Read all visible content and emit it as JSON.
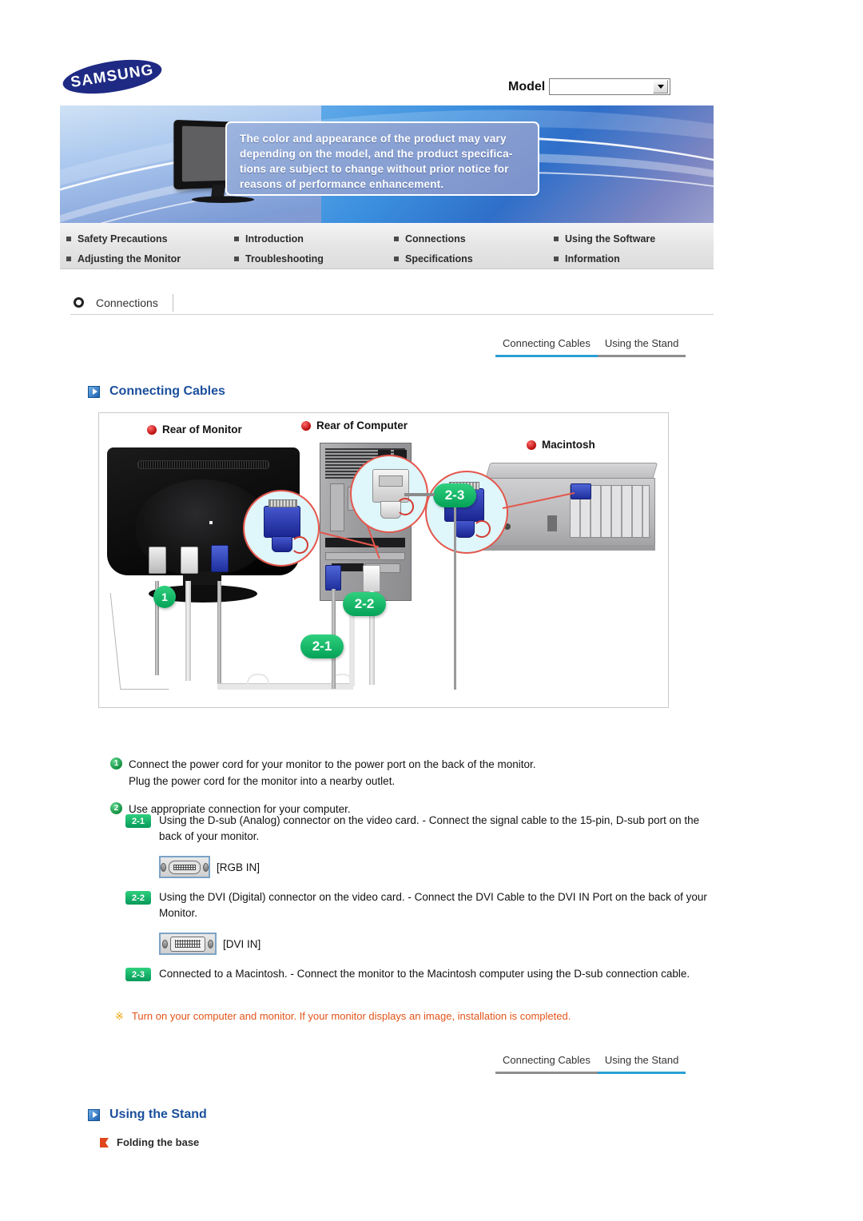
{
  "brand": {
    "logo_text": "SAMSUNG"
  },
  "model_selector": {
    "label": "Model",
    "value": "",
    "placeholder": "",
    "arrow_icon": "chevron-down-icon"
  },
  "banner": {
    "notice": "The color and appearance of the product may vary depending on the model, and the product specifications are subject to change without prior notice for reasons of performance enhancement.",
    "notice_lines": [
      "The color and appearance of the product may vary",
      "depending on the model, and the product specifica-",
      "tions are subject to change without prior notice for",
      "reasons of performance enhancement."
    ]
  },
  "nav": {
    "items": [
      {
        "label": "Safety Precautions"
      },
      {
        "label": "Introduction"
      },
      {
        "label": "Connections"
      },
      {
        "label": "Using the Software"
      },
      {
        "label": "Adjusting the Monitor"
      },
      {
        "label": "Troubleshooting"
      },
      {
        "label": "Specifications"
      },
      {
        "label": "Information"
      }
    ]
  },
  "breadcrumb": {
    "section": "Connections"
  },
  "tabs_top": [
    {
      "label": "Connecting Cables",
      "active": true
    },
    {
      "label": "Using the Stand",
      "active": false
    }
  ],
  "tabs_bottom": [
    {
      "label": "Connecting Cables",
      "active": false
    },
    {
      "label": "Using the Stand",
      "active": true
    }
  ],
  "headings": {
    "connecting_cables": "Connecting Cables",
    "using_the_stand": "Using the Stand",
    "folding_the_base": "Folding the base"
  },
  "figure": {
    "labels": {
      "rear_of_monitor": "Rear of Monitor",
      "rear_of_computer": "Rear of Computer",
      "macintosh": "Macintosh"
    },
    "badges": {
      "one": "1",
      "two_one": "2-1",
      "two_two": "2-2",
      "two_three": "2-3"
    }
  },
  "instructions": [
    {
      "num": "1",
      "lines": [
        "Connect the power cord for your monitor to the power port on the back of the monitor.",
        "Plug the power cord for the monitor into a nearby outlet."
      ]
    },
    {
      "num": "2",
      "lines": [
        "Use appropriate connection for your computer."
      ]
    }
  ],
  "sub_instructions": [
    {
      "badge": "2-1",
      "lines": [
        "Using the D-sub (Analog) connector on the video card.",
        "- Connect the signal cable to the 15-pin, D-sub port on the back of your monitor."
      ],
      "port_caption": "[RGB IN]",
      "port_icon": "dsub-port-icon"
    },
    {
      "badge": "2-2",
      "lines": [
        "Using the DVI (Digital) connector on the video card.",
        "- Connect the DVI Cable to the DVI IN Port on the back of your Monitor."
      ],
      "port_caption": "[DVI IN]",
      "port_icon": "dvi-port-icon"
    },
    {
      "badge": "2-3",
      "lines": [
        "Connected to a Macintosh.",
        "- Connect the monitor to the Macintosh computer using the D-sub connection cable."
      ],
      "port_caption": "",
      "port_icon": ""
    }
  ],
  "note": {
    "mark": "※",
    "text": "Turn on your computer and monitor. If your monitor displays an image, installation is completed."
  },
  "colors": {
    "brand_blue": "#1f2a84",
    "heading_blue": "#1b4f9c",
    "tab_active": "#2b9fd4",
    "tab_inactive": "#8e8e8e",
    "badge_green": "#04a257",
    "note_orange": "#e2541a",
    "note_mark": "#f0a000",
    "bullet_red": "#e0451c"
  }
}
